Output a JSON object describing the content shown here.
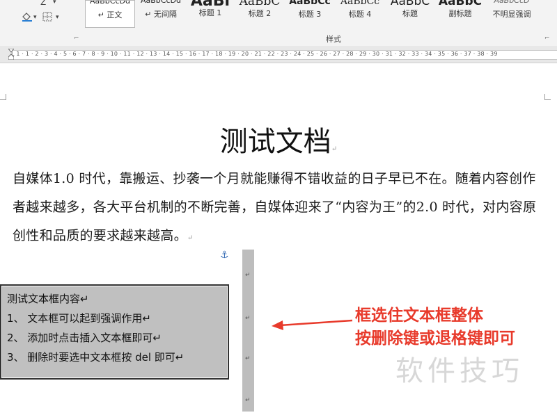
{
  "ribbon": {
    "font_tools": {
      "row1": [
        "A",
        "Z",
        "▾"
      ],
      "row2_icons": [
        "paint-bucket-icon",
        "text-highlight-a-icon",
        "borders-icon"
      ]
    },
    "styles": [
      {
        "sample": "AaBbCcDd",
        "name": "↵ 正文",
        "selected": true
      },
      {
        "sample": "AaBbCcDd",
        "name": "↵ 无间隔",
        "selected": false
      },
      {
        "sample": "AaBl",
        "name": "标题 1",
        "selected": false
      },
      {
        "sample": "AaBbC",
        "name": "标题 2",
        "selected": false
      },
      {
        "sample": "AaBbCc",
        "name": "标题 3",
        "selected": false
      },
      {
        "sample": "AaBbCc",
        "name": "标题 4",
        "selected": false
      },
      {
        "sample": "AaBbC",
        "name": "标题",
        "selected": false
      },
      {
        "sample": "AaBbC",
        "name": "副标题",
        "selected": false
      },
      {
        "sample": "AaBbCcD",
        "name": "不明显强调",
        "selected": false
      }
    ],
    "group_label": "样式",
    "launcher_glyph": "⌐"
  },
  "ruler": {
    "numbers": "L  1 · 1 · 2 · 3 · 4 · 5 · 6 · 7 · 8 · 9 · 10 · 11 · 12 · 13 · 14 · 15 · 16 · 17 · 18 · 19 · 20 · 21 · 22 · 23 · 24 · 25 · 26 · 27 · 28 · 29 · 30 · 31 · 32 · 33 · 34 · 35 · 36 · 37 · 38 · 39"
  },
  "document": {
    "title": "测试文档",
    "body": "自媒体1.0 时代，靠搬运、抄袭一个月就能赚得不错收益的日子早已不在。随着内容创作者越来越多，各大平台机制的不断完善，自媒体迎来了“内容为王”的2.0 时代，对内容原创性和品质的要求越来越高。",
    "paragraph_mark": "↵"
  },
  "textbox": {
    "lines": [
      "测试文本框内容↵",
      "1、 文本框可以起到强调作用↵",
      "2、 添加时点击插入文本框即可↵",
      "3、 删除时要选中文本框按 del 即可↵"
    ]
  },
  "callout": {
    "line1": "框选住文本框整体",
    "line2": "按删除键或退格键即可",
    "color": "#e83a2b"
  },
  "watermark": "软件技巧",
  "colors": {
    "ribbon_bg": "#f3f3f3",
    "textbox_bg": "#c0c0c0",
    "anchor": "#3b6fb6"
  }
}
